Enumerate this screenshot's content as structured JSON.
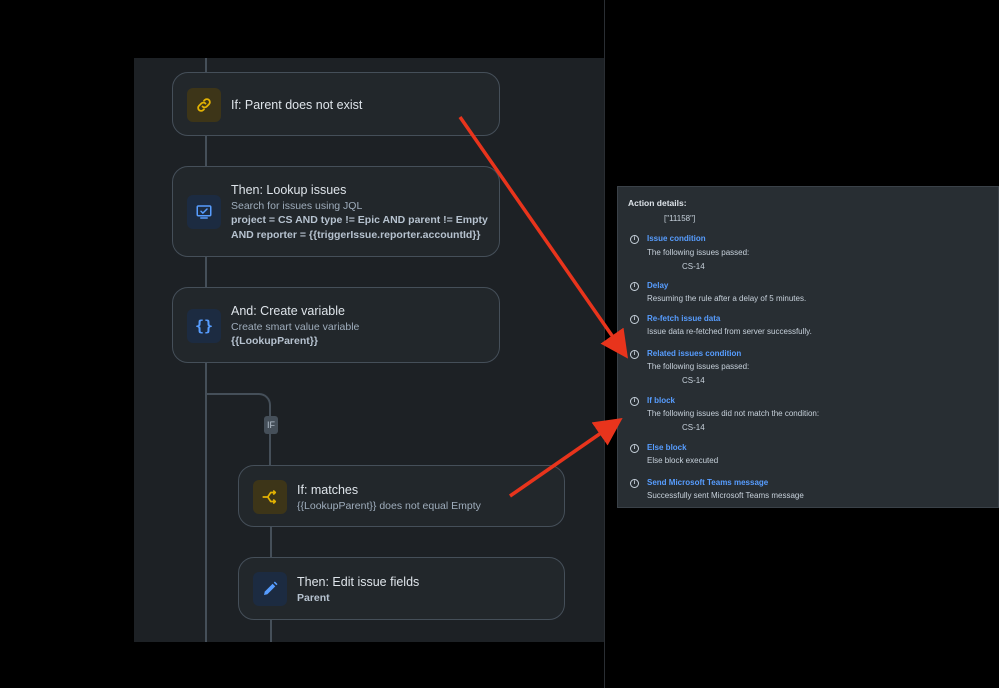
{
  "flow": {
    "if_parent": {
      "title": "If: Parent does not exist",
      "icon": "link-icon"
    },
    "lookup": {
      "title": "Then: Lookup issues",
      "subtitle": "Search for issues using JQL",
      "jql_line1": "project = CS AND type != Epic AND parent != Empty",
      "jql_line2": "AND reporter = {{triggerIssue.reporter.accountId}}",
      "icon": "search-issues-icon"
    },
    "create_var": {
      "title": "And: Create variable",
      "subtitle": "Create smart value variable",
      "value": "{{LookupParent}}",
      "icon": "braces-icon"
    },
    "if_badge": "IF",
    "matches": {
      "title": "If: matches",
      "subtitle": "{{LookupParent}} does not equal Empty",
      "icon": "branch-icon"
    },
    "edit": {
      "title": "Then: Edit issue fields",
      "value": "Parent",
      "icon": "pencil-icon"
    }
  },
  "details": {
    "header": "Action details:",
    "first_value": "[\"11158\"]",
    "entries": [
      {
        "title": "Issue condition",
        "text": "The following issues passed:",
        "value": "CS-14"
      },
      {
        "title": "Delay",
        "text": "Resuming the rule after a delay of 5 minutes."
      },
      {
        "title": "Re-fetch issue data",
        "text": "Issue data re-fetched from server successfully."
      },
      {
        "title": "Related issues condition",
        "text": "The following issues passed:",
        "value": "CS-14"
      },
      {
        "title": "If block",
        "text": "The following issues did not match the condition:",
        "value": "CS-14"
      },
      {
        "title": "Else block",
        "text": "Else block executed"
      },
      {
        "title": "Send Microsoft Teams message",
        "text": "Successfully sent Microsoft Teams message"
      }
    ]
  },
  "colors": {
    "arrow": "#e8341c",
    "link": "#579dff",
    "yellow_icon": "#e2b203",
    "blue_icon": "#579dff"
  }
}
